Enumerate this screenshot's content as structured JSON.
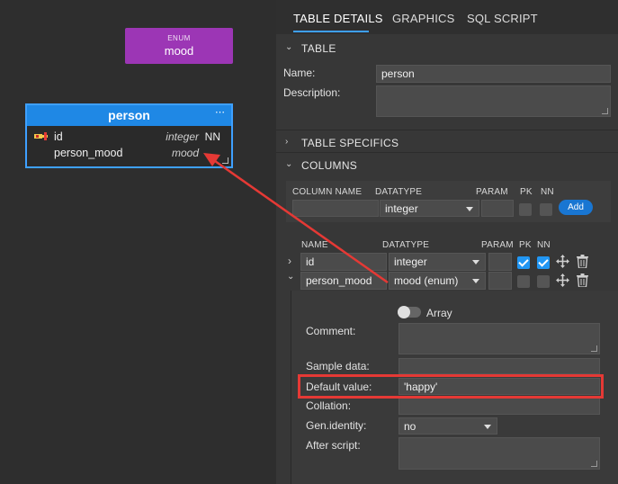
{
  "canvas": {
    "enum": {
      "kind": "ENUM",
      "name": "mood"
    },
    "entity": {
      "name": "person",
      "menu_glyph": "⋯",
      "columns": [
        {
          "name": "id",
          "type": "integer",
          "flag": "NN",
          "pk": true
        },
        {
          "name": "person_mood",
          "type": "mood",
          "flag": "",
          "pk": false
        }
      ]
    }
  },
  "tabs": [
    "TABLE DETAILS",
    "GRAPHICS",
    "SQL SCRIPT"
  ],
  "table_section": {
    "title": "TABLE",
    "name_label": "Name:",
    "name_value": "person",
    "description_label": "Description:",
    "description_value": ""
  },
  "specifics_section": {
    "title": "TABLE SPECIFICS"
  },
  "columns_section": {
    "title": "COLUMNS",
    "new_headers": {
      "name": "COLUMN NAME",
      "datatype": "DATATYPE",
      "param": "PARAM",
      "pk": "PK",
      "nn": "NN"
    },
    "new_datatype": "integer",
    "add_label": "Add",
    "list_headers": {
      "name": "NAME",
      "datatype": "DATATYPE",
      "param": "PARAM",
      "pk": "PK",
      "nn": "NN"
    },
    "rows": [
      {
        "name": "id",
        "datatype": "integer",
        "param": "",
        "pk": true,
        "nn": true
      },
      {
        "name": "person_mood",
        "datatype": "mood (enum)",
        "param": "",
        "pk": false,
        "nn": false
      }
    ]
  },
  "column_details": {
    "array_label": "Array",
    "comment_label": "Comment:",
    "sample_label": "Sample data:",
    "default_label": "Default value:",
    "default_value": "'happy'",
    "collation_label": "Collation:",
    "identity_label": "Gen.identity:",
    "identity_value": "no",
    "after_label": "After script:"
  },
  "colors": {
    "accent": "#1f88e5",
    "enum": "#9c36b5",
    "highlight": "#e53935"
  }
}
